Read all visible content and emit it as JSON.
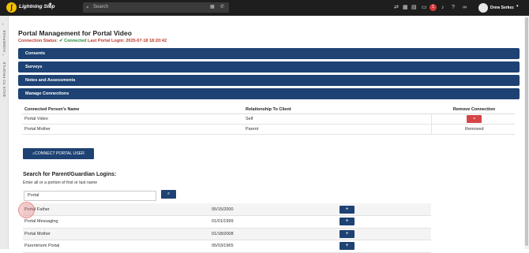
{
  "header": {
    "brand": "Lightning Step",
    "logo_letter": "ʃ",
    "search_placeholder": "Search",
    "notification_count": "1",
    "user_name": "Drew Serkez",
    "icons": [
      "transfer-icon",
      "calendar-icon",
      "inbox-icon",
      "chat-icon",
      "bell-icon",
      "help-icon",
      "link-icon"
    ]
  },
  "sidebar": {
    "homepage": "HOMEPAGE",
    "back": "BACK TO PROFILE"
  },
  "page": {
    "title": "Portal Management for Portal Video",
    "status_label": "Connection Status:",
    "status_value": "Connected",
    "last_login": "Last Portal Login: 2025-07-18 18:20:42"
  },
  "panels": [
    "Consents",
    "Surveys",
    "Notes and Assessments",
    "Manage Connections"
  ],
  "connections": {
    "headers": [
      "Connected Person's Name",
      "Relationship To Client",
      "Remove Connection"
    ],
    "rows": [
      {
        "name": "Portal Video",
        "relationship": "Self",
        "remove": "×"
      },
      {
        "name": "Portal Mother",
        "relationship": "Parent",
        "remove": "Removed"
      }
    ]
  },
  "connect_button": "CONNECT PORTAL USER",
  "search_section": {
    "heading": "Search for Parent/Guardian Logins:",
    "hint": "Enter all or a portion of first or last name",
    "input_value": "Portal",
    "button_icon": "search-icon"
  },
  "results": [
    {
      "name": "Portal Father",
      "dob": "05/15/2000",
      "action": "+"
    },
    {
      "name": "Portal Messaging",
      "dob": "01/01/1999",
      "action": "+"
    },
    {
      "name": "Portal Mother",
      "dob": "01/18/2008",
      "action": "+"
    },
    {
      "name": "Parentmom Portal",
      "dob": "05/03/1965",
      "action": "+"
    }
  ],
  "colors": {
    "topbar": "#1e1e1e",
    "panel": "#1d4273",
    "danger": "#d64545",
    "status_text": "#c0392b",
    "connected": "#2a8a3e",
    "logo": "#f2c100"
  }
}
